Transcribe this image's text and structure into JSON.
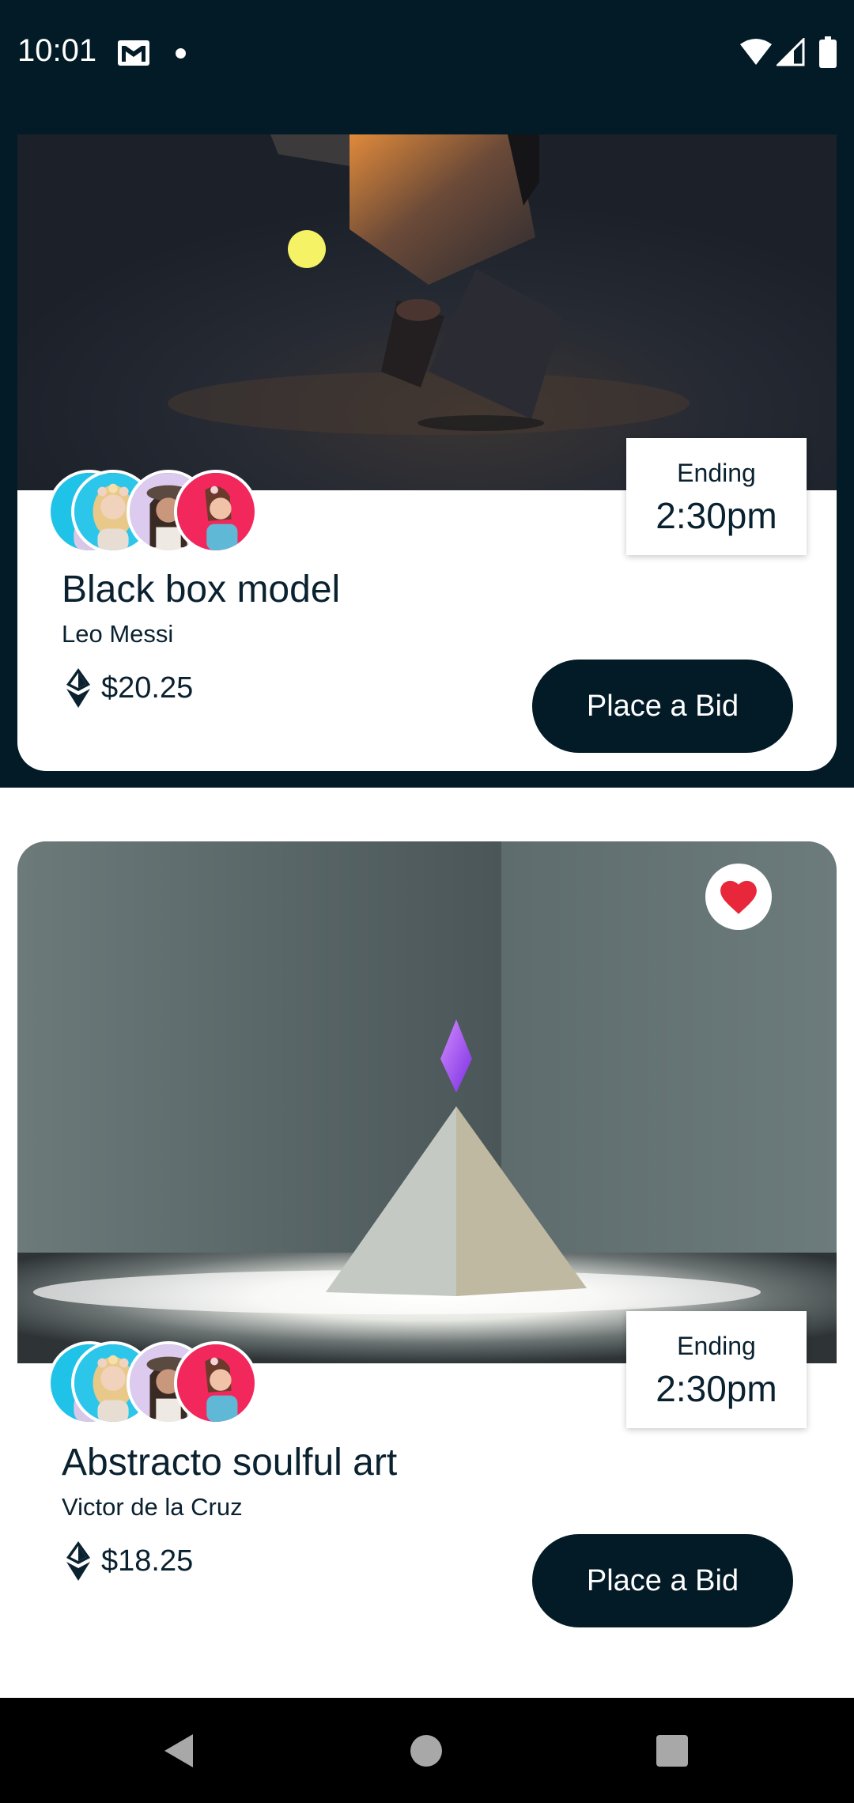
{
  "status_bar": {
    "time": "10:01",
    "icons": [
      "gmail-icon",
      "notification-dot-icon",
      "wifi-icon",
      "cell-signal-icon",
      "battery-icon"
    ]
  },
  "cards": [
    {
      "title": "Black box model",
      "author": "Leo Messi",
      "ending_label": "Ending",
      "ending_time": "2:30pm",
      "price": "$20.25",
      "bid_label": "Place a Bid",
      "image": "dark-boxes-render"
    },
    {
      "title": "Abstracto soulful art",
      "author": "Victor de la Cruz",
      "ending_label": "Ending",
      "ending_time": "2:30pm",
      "price": "$18.25",
      "bid_label": "Place a Bid",
      "image": "pyramid-crystal-render",
      "favorited": true
    }
  ],
  "colors": {
    "primary_dark": "#031b26",
    "heart": "#e8283a",
    "text": "#0a2130"
  },
  "nav_bar": {
    "icons": [
      "back-icon",
      "home-icon",
      "recents-icon"
    ]
  }
}
